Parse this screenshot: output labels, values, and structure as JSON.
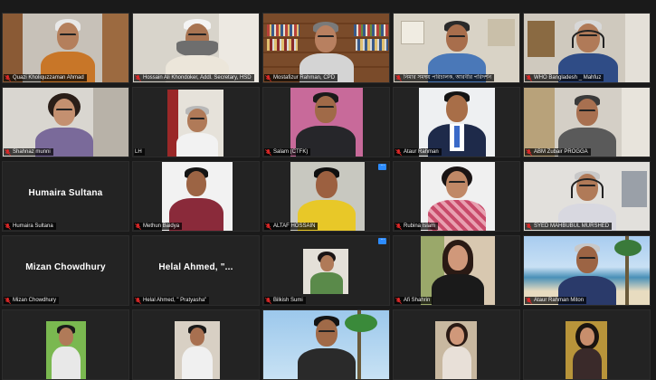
{
  "participants": [
    {
      "name": "Quazi Kholiquzzaman Ahmad"
    },
    {
      "name": "Hossain Ali Khondoker, Addl. Secretary, HSD"
    },
    {
      "name": "Mostafizur Rahman, CPD"
    },
    {
      "name": "নিমার সমম্বয় পরিচালক, আরবীর পরিদর্শন"
    },
    {
      "name": "WHO Bangladesh _ Mahfuz"
    },
    {
      "name": "Shahnaz munni"
    },
    {
      "name": "LH"
    },
    {
      "name": "Salam (CTFK)"
    },
    {
      "name": "Ataur Rahman"
    },
    {
      "name": "ABM Zubair PROGGA"
    },
    {
      "name": "Humaira Sultana",
      "display_name": "Humaira Sultana"
    },
    {
      "name": "Methun Baidya"
    },
    {
      "name": "ALTAF HOSSAIN"
    },
    {
      "name": "Rubina Islam"
    },
    {
      "name": "SYED MAHBUBUL MURSHED"
    },
    {
      "name": "Mizan Chowdhury",
      "display_name": "Mizan Chowdhury"
    },
    {
      "name": "Helal Ahmed, \" Pratyasha\"",
      "display_name": "Helal Ahmed, \"..."
    },
    {
      "name": "Bilkish Sumi"
    },
    {
      "name": "Afi Shahrin"
    },
    {
      "name": "Ataur Rahman Miton"
    }
  ],
  "colors": {
    "background": "#1a1a1a",
    "tile": "#232323",
    "mic_muted": "#e02828",
    "zoom_blue": "#2d8cff"
  },
  "icons": {
    "muted_mic": "mic-muted-icon",
    "more_options": "more-options-icon"
  }
}
